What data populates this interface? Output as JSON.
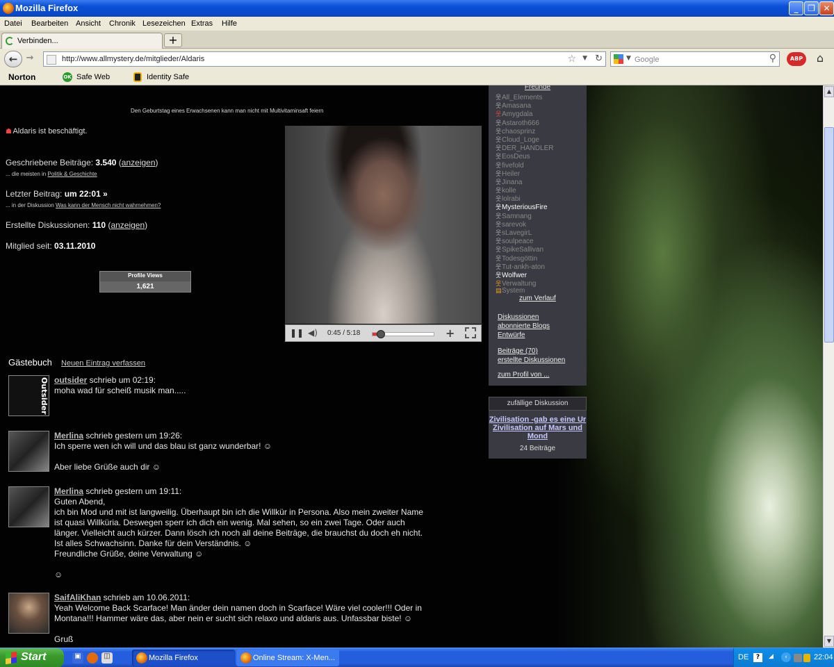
{
  "window": {
    "title": "Mozilla Firefox"
  },
  "menu": [
    "Datei",
    "Bearbeiten",
    "Ansicht",
    "Chronik",
    "Lesezeichen",
    "Extras",
    "Hilfe"
  ],
  "tab": {
    "label": "Verbinden...",
    "new_tab": "+"
  },
  "nav": {
    "url": "http://www.allmystery.de/mitglieder/Aldaris",
    "search_placeholder": "Google",
    "abp": "ABP"
  },
  "toolbar": {
    "norton": "Norton",
    "safe_web": "Safe Web",
    "identity_safe": "Identity Safe",
    "ok_badge": "OK"
  },
  "profile": {
    "quote": "Den Geburtstag eines Erwachsenen kann man nicht mit Multivitaminsaft feiern",
    "status": "Aldaris ist beschäftigt.",
    "posts_label": "Geschriebene Beiträge:",
    "posts_value": "3.540",
    "posts_link": "anzeigen",
    "posts_sub_prefix": "... die meisten in",
    "posts_sub_link": "Politik & Geschichte",
    "last_post_label": "Letzter Beitrag:",
    "last_post_value": "um 22:01 »",
    "last_post_sub_prefix": "... in der Diskussion",
    "last_post_sub_link": "Was kann der Mensch nicht wahrnehmen?",
    "discussions_label": "Erstellte Diskussionen:",
    "discussions_value": "110",
    "discussions_link": "anzeigen",
    "member_label": "Mitglied seit:",
    "member_value": "03.11.2010",
    "profile_views_label": "Profile Views",
    "profile_views_value": "1,621"
  },
  "player": {
    "time": "0:45 / 5:18",
    "progress": 0.142
  },
  "guestbook": {
    "heading": "Gästebuch",
    "new_entry": "Neuen Eintrag verfassen",
    "entries": [
      {
        "author": "outsider",
        "meta": " schrieb um 02:19:",
        "text": "moha wad für scheiß musik man.....",
        "avatar_text": "Outsider"
      },
      {
        "author": "Merlina",
        "meta": " schrieb gestern um 19:26:",
        "text": "Ich sperre wen ich will und das blau ist ganz wunderbar! ☺\n\nAber liebe Grüße auch dir ☺"
      },
      {
        "author": "Merlina",
        "meta": " schrieb gestern um 19:11:",
        "text": "Guten Abend,\nich bin Mod und mit ist langweilig. Überhaupt bin ich die Willkür in Persona. Also mein zweiter Name ist quasi Willküria. Deswegen sperr ich dich ein wenig. Mal sehen, so ein zwei Tage. Oder auch länger. Vielleicht auch kürzer. Dann lösch ich noch all deine Beiträge, die brauchst du doch eh nicht. Ist alles Schwachsinn. Danke für dein Verständnis. ☺\nFreundliche Grüße, deine Verwaltung ☺\n\n☺"
      },
      {
        "author": "SaifAliKhan",
        "meta": " schrieb am 10.06.2011:",
        "text": "Yeah Welcome Back Scarface! Man änder dein namen doch in Scarface! Wäre viel cooler!!! Oder in Montana!!! Hammer wäre das, aber nein er sucht sich relaxo und aldaris aus. Unfassbar biste! ☺\n\nGruß"
      }
    ]
  },
  "sidebar": {
    "friends_heading": "Freunde",
    "friends": [
      {
        "name": "All_Elements",
        "state": "off"
      },
      {
        "name": "Amasana",
        "state": "off"
      },
      {
        "name": "Amygdala",
        "state": "red"
      },
      {
        "name": "Astaroth666",
        "state": "off"
      },
      {
        "name": "chaosprinz",
        "state": "off"
      },
      {
        "name": "Cloud_Loge",
        "state": "off"
      },
      {
        "name": "DER_HANDLER",
        "state": "off"
      },
      {
        "name": "EosDeus",
        "state": "off"
      },
      {
        "name": "fivefold",
        "state": "off"
      },
      {
        "name": "Heiler",
        "state": "off"
      },
      {
        "name": "Jinana",
        "state": "off"
      },
      {
        "name": "kolle",
        "state": "off"
      },
      {
        "name": "lolrabi",
        "state": "off"
      },
      {
        "name": "MysteriousFire",
        "state": "on"
      },
      {
        "name": "Samnang",
        "state": "off"
      },
      {
        "name": "sarevok",
        "state": "off"
      },
      {
        "name": "sLavegirL",
        "state": "off"
      },
      {
        "name": "soulpeace",
        "state": "off"
      },
      {
        "name": "SpikeSallivan",
        "state": "off"
      },
      {
        "name": "Todesgöttin",
        "state": "off"
      },
      {
        "name": "Tut-ankh-aton",
        "state": "off"
      },
      {
        "name": "Wolfwer",
        "state": "on"
      },
      {
        "name": "Verwaltung",
        "state": "org"
      },
      {
        "name": "System",
        "state": "org"
      }
    ],
    "history_link": "zum Verlauf",
    "discussions": "Diskussionen",
    "subscribed_blogs": "abonnierte Blogs",
    "drafts": "Entwürfe",
    "posts": "Beiträge (70)",
    "created_discussions": "erstellte Diskussionen",
    "profile_of": "zum Profil von ..."
  },
  "random_discussion": {
    "heading": "zufällige Diskussion",
    "title": "Zivilisation -gab es eine Ur Zivilisation auf Mars und Mond",
    "count": "24 Beiträge"
  },
  "taskbar": {
    "start": "Start",
    "items": [
      "Mozilla Firefox",
      "Online Stream: X-Men..."
    ],
    "lang": "DE",
    "clock": "22:04"
  }
}
